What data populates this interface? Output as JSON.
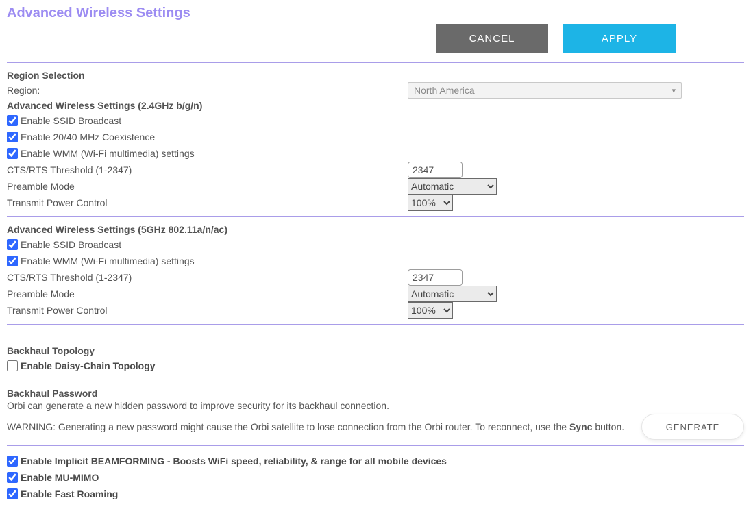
{
  "header": {
    "title": "Advanced Wireless Settings",
    "cancel": "CANCEL",
    "apply": "APPLY"
  },
  "region": {
    "heading": "Region Selection",
    "label": "Region:",
    "value": "North America"
  },
  "band24": {
    "heading": "Advanced Wireless Settings (2.4GHz b/g/n)",
    "ssid_broadcast": {
      "label": "Enable SSID Broadcast",
      "checked": true
    },
    "coexistence": {
      "label": "Enable 20/40 MHz Coexistence",
      "checked": true
    },
    "wmm": {
      "label": "Enable WMM (Wi-Fi multimedia) settings",
      "checked": true
    },
    "cts_label": "CTS/RTS Threshold (1-2347)",
    "cts_value": "2347",
    "preamble_label": "Preamble Mode",
    "preamble_value": "Automatic",
    "power_label": "Transmit Power Control",
    "power_value": "100%"
  },
  "band5": {
    "heading": "Advanced Wireless Settings (5GHz 802.11a/n/ac)",
    "ssid_broadcast": {
      "label": "Enable SSID Broadcast",
      "checked": true
    },
    "wmm": {
      "label": "Enable WMM (Wi-Fi multimedia) settings",
      "checked": true
    },
    "cts_label": "CTS/RTS Threshold (1-2347)",
    "cts_value": "2347",
    "preamble_label": "Preamble Mode",
    "preamble_value": "Automatic",
    "power_label": "Transmit Power Control",
    "power_value": "100%"
  },
  "backhaul": {
    "topology_heading": "Backhaul Topology",
    "daisy": {
      "label": "Enable Daisy-Chain Topology",
      "checked": false
    },
    "password_heading": "Backhaul Password",
    "desc": "Orbi can generate a new hidden password to improve security for its backhaul connection.",
    "warning_prefix": "WARNING: Generating a new password might cause the Orbi satellite to lose connection from the Orbi router. To reconnect, use the ",
    "sync_word": "Sync",
    "warning_suffix": " button.",
    "generate": "GENERATE"
  },
  "features": {
    "beamforming": {
      "label": "Enable Implicit BEAMFORMING - Boosts WiFi speed, reliability, & range for all mobile devices",
      "checked": true
    },
    "mumimo": {
      "label": "Enable MU-MIMO",
      "checked": true
    },
    "fast_roaming": {
      "label": "Enable Fast Roaming",
      "checked": true
    }
  }
}
